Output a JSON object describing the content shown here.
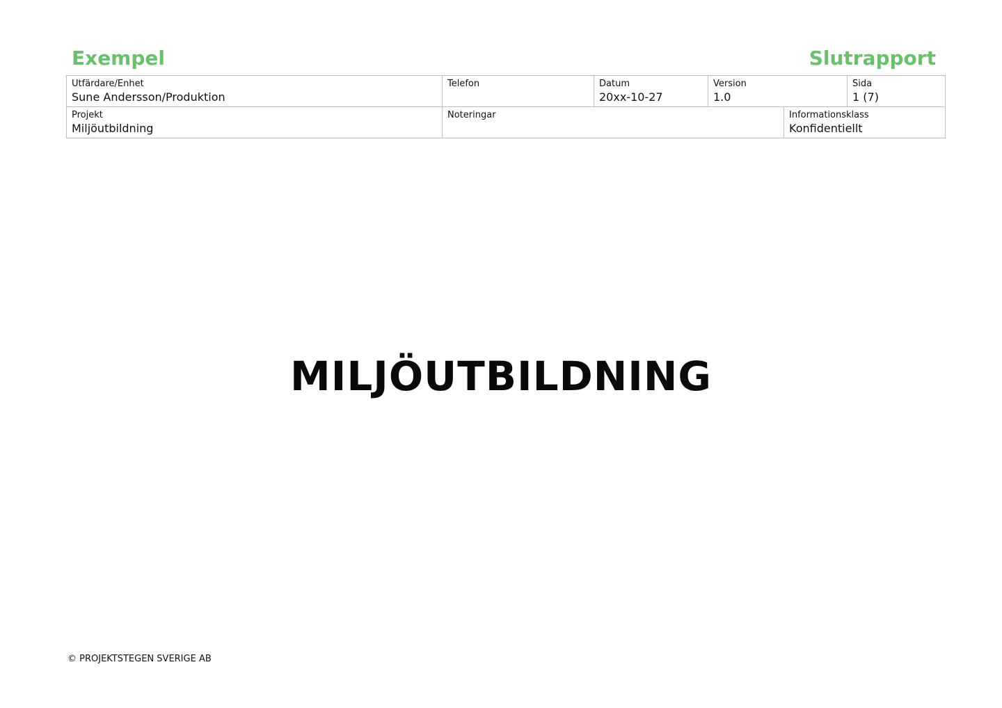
{
  "header": {
    "left_title": "Exempel",
    "right_title": "Slutrapport",
    "accent_color": "#6cbf6c"
  },
  "meta": {
    "issuer": {
      "label": "Utfärdare/Enhet",
      "value": "Sune Andersson/Produktion"
    },
    "phone": {
      "label": "Telefon",
      "value": ""
    },
    "date": {
      "label": "Datum",
      "value": "20xx-10-27"
    },
    "version": {
      "label": "Version",
      "value": "1.0"
    },
    "page": {
      "label": "Sida",
      "value": "1 (7)"
    },
    "project": {
      "label": "Projekt",
      "value": "Miljöutbildning"
    },
    "notes": {
      "label": "Noteringar",
      "value": ""
    },
    "classification": {
      "label": "Informationsklass",
      "value": "Konfidentiellt"
    }
  },
  "main": {
    "title": "MILJÖUTBILDNING"
  },
  "footer": {
    "copyright": "© PROJEKTSTEGEN SVERIGE AB"
  }
}
